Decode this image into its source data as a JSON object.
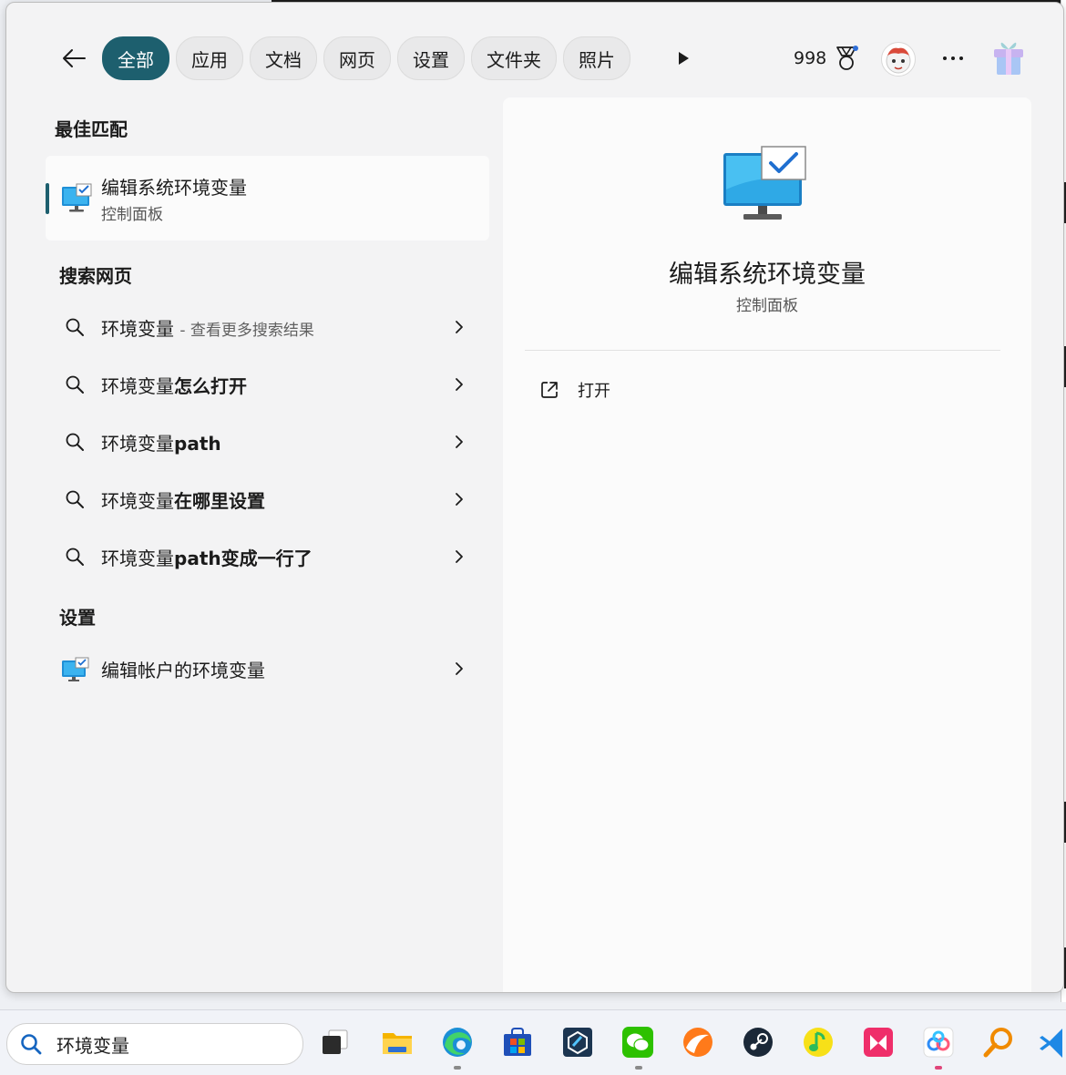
{
  "filters": [
    {
      "label": "全部",
      "active": true
    },
    {
      "label": "应用",
      "active": false
    },
    {
      "label": "文档",
      "active": false
    },
    {
      "label": "网页",
      "active": false
    },
    {
      "label": "设置",
      "active": false
    },
    {
      "label": "文件夹",
      "active": false
    },
    {
      "label": "照片",
      "active": false
    }
  ],
  "header": {
    "points": "998"
  },
  "best_match": {
    "section_title": "最佳匹配",
    "title": "编辑系统环境变量",
    "subtitle": "控制面板"
  },
  "web_search": {
    "section_title": "搜索网页",
    "items": [
      {
        "query": "环境变量",
        "bold_suffix": "",
        "extra": "- 查看更多搜索结果"
      },
      {
        "query": "环境变量",
        "bold_suffix": "怎么打开",
        "extra": ""
      },
      {
        "query": "环境变量",
        "bold_suffix": "path",
        "extra": ""
      },
      {
        "query": "环境变量",
        "bold_suffix": "在哪里设置",
        "extra": ""
      },
      {
        "query": "环境变量",
        "bold_suffix": "path变成一行了",
        "extra": ""
      }
    ]
  },
  "settings": {
    "section_title": "设置",
    "items": [
      {
        "label": "编辑帐户的环境变量"
      }
    ]
  },
  "detail": {
    "title": "编辑系统环境变量",
    "subtitle": "控制面板",
    "actions": [
      {
        "label": "打开"
      }
    ]
  },
  "taskbar": {
    "search_value": "环境变量",
    "apps": [
      "task-view",
      "file-explorer",
      "edge",
      "microsoft-store",
      "app-cube",
      "wechat",
      "orange-browser",
      "steam",
      "qq-music",
      "pink-app",
      "baidu-netdisk",
      "search-tool",
      "vscode"
    ]
  },
  "colors": {
    "accent": "#1d5f6e",
    "panel_bg": "#f3f3f4"
  }
}
